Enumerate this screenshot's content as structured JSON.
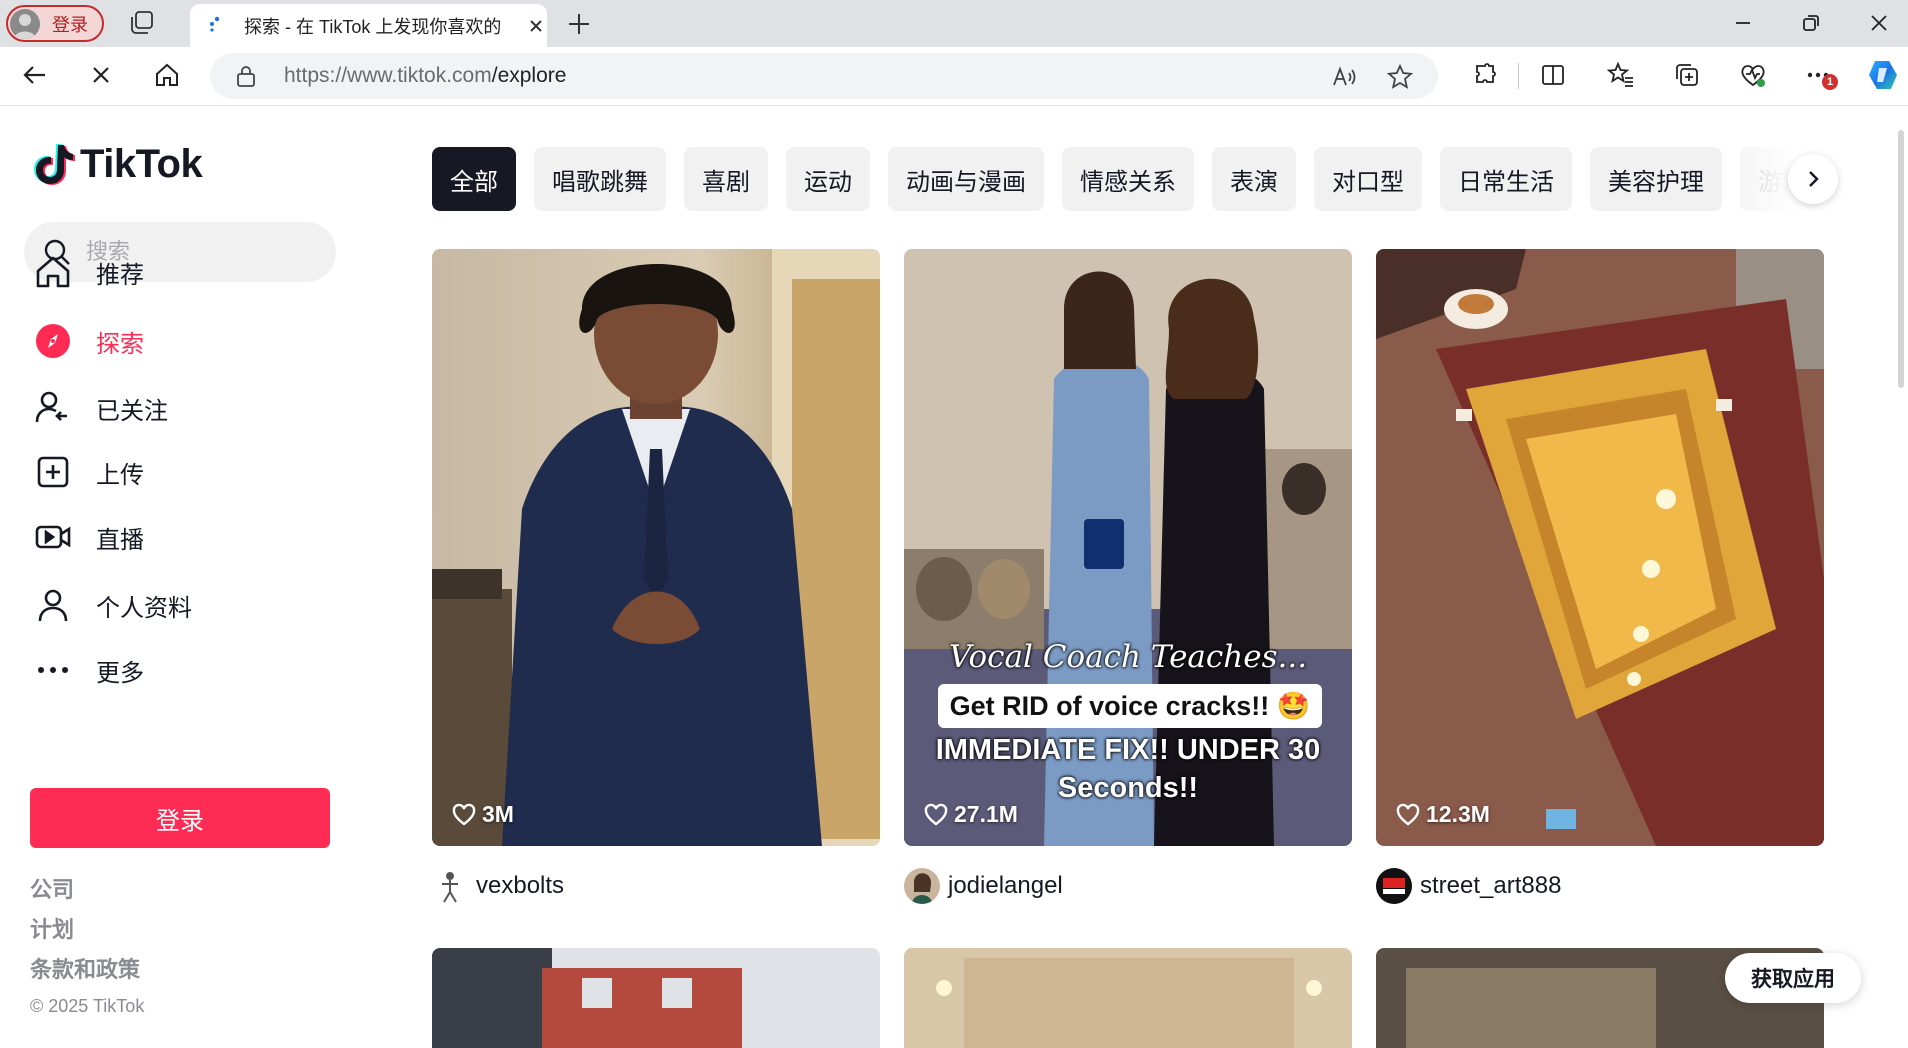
{
  "browser": {
    "profile_label": "登录",
    "tab_title": "探索 - 在 TikTok 上发现你喜欢的",
    "url_host": "https://www.tiktok.com",
    "url_path": "/explore",
    "notification_count": "1"
  },
  "brand": {
    "name": "TikTok"
  },
  "search": {
    "placeholder": "搜索"
  },
  "nav": {
    "items": [
      {
        "label": "推荐",
        "icon": "home-icon"
      },
      {
        "label": "探索",
        "icon": "compass-icon",
        "active": true
      },
      {
        "label": "已关注",
        "icon": "following-icon"
      },
      {
        "label": "上传",
        "icon": "upload-icon"
      },
      {
        "label": "直播",
        "icon": "live-icon"
      },
      {
        "label": "个人资料",
        "icon": "profile-icon"
      },
      {
        "label": "更多",
        "icon": "more-icon"
      }
    ]
  },
  "login_button": "登录",
  "footer": {
    "links": [
      "公司",
      "计划",
      "条款和政策"
    ],
    "copyright": "© 2025 TikTok"
  },
  "categories": [
    "全部",
    "唱歌跳舞",
    "喜剧",
    "运动",
    "动画与漫画",
    "情感关系",
    "表演",
    "对口型",
    "日常生活",
    "美容护理",
    "游戏"
  ],
  "active_category": "全部",
  "videos": [
    {
      "likes": "3M",
      "author": "vexbolts"
    },
    {
      "likes": "27.1M",
      "author": "jodielangel",
      "caption_title": "Vocal Coach Teaches...",
      "caption_box": "Get RID of voice cracks!! 🤩",
      "caption_line1": "IMMEDIATE FIX!! UNDER 30",
      "caption_line2": "Seconds!!"
    },
    {
      "likes": "12.3M",
      "author": "street_art888"
    }
  ],
  "get_app_button": "获取应用",
  "colors": {
    "accent": "#fe2c55",
    "text": "#161823",
    "chip_bg": "#f1f1f2"
  }
}
